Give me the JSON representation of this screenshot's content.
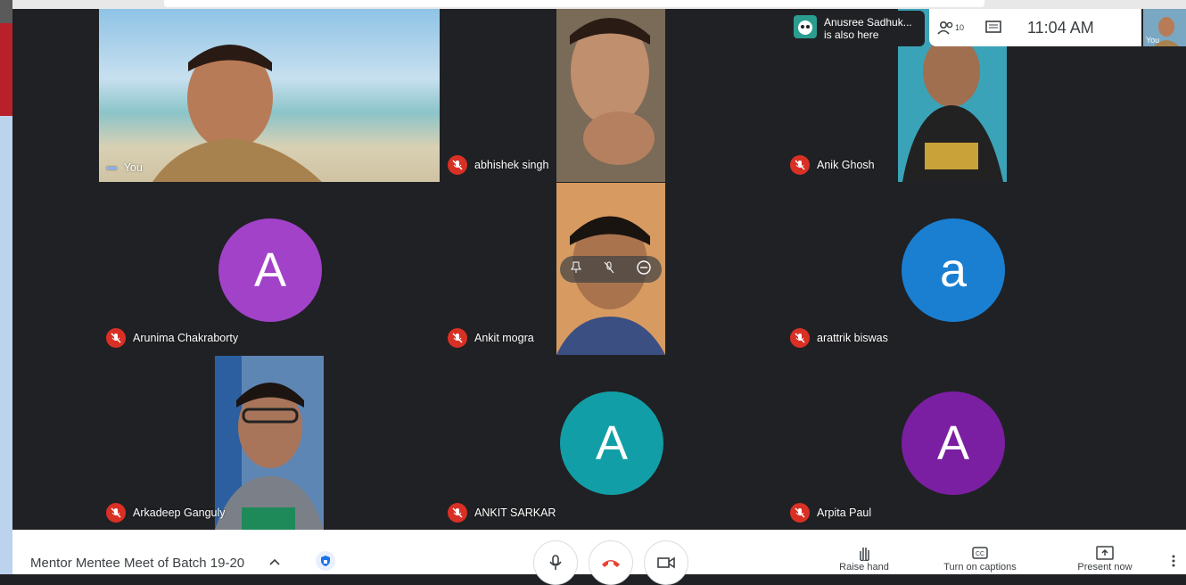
{
  "meeting": {
    "title": "Mentor Mentee Meet of Batch 19-20",
    "time": "11:04 AM",
    "participants_count": "10"
  },
  "notice": {
    "name": "Anusree Sadhuk...",
    "message": "is also here"
  },
  "self_thumb_label": "You",
  "participants": [
    {
      "name": "You",
      "kind": "video",
      "muted": false
    },
    {
      "name": "abhishek singh",
      "kind": "video",
      "muted": true
    },
    {
      "name": "Anik Ghosh",
      "kind": "video",
      "muted": true
    },
    {
      "name": "Arunima Chakraborty",
      "kind": "avatar",
      "initial": "A",
      "color": "#a142c9",
      "muted": true
    },
    {
      "name": "Ankit mogra",
      "kind": "video",
      "muted": true
    },
    {
      "name": "arattrik biswas",
      "kind": "avatar",
      "initial": "a",
      "color": "#1a7fd1",
      "muted": true
    },
    {
      "name": "Arkadeep Ganguly",
      "kind": "video",
      "muted": true
    },
    {
      "name": "ANKIT SARKAR",
      "kind": "avatar",
      "initial": "A",
      "color": "#129ea6",
      "muted": true
    },
    {
      "name": "Arpita Paul",
      "kind": "avatar",
      "initial": "A",
      "color": "#7b1fa2",
      "muted": true
    }
  ],
  "actions": {
    "raise_hand": "Raise hand",
    "captions": "Turn on captions",
    "present": "Present now"
  },
  "icons": [
    "microphone-icon",
    "end-call-icon",
    "camera-icon",
    "hand-icon",
    "captions-icon",
    "present-icon",
    "more-icon",
    "people-icon",
    "chat-icon",
    "shield-icon"
  ],
  "colors": {
    "end_call": "#ea4335",
    "mute_badge": "#d93025",
    "shield": "#1a73e8"
  }
}
